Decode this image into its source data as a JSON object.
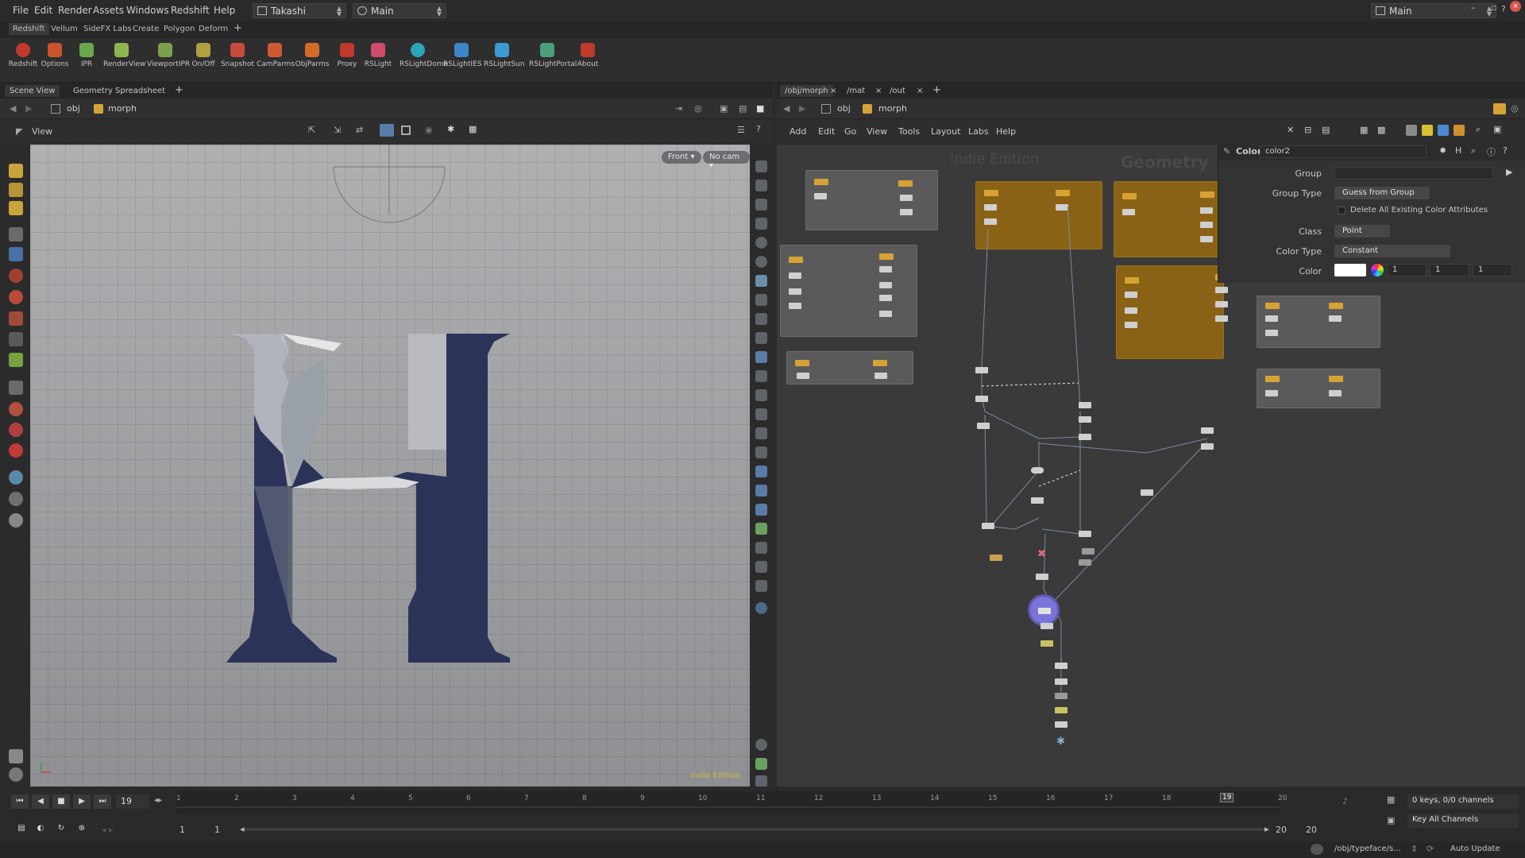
{
  "menubar": {
    "items": [
      "File",
      "Edit",
      "Render",
      "Assets",
      "Windows",
      "Redshift",
      "Help"
    ],
    "desktop": "Takashi",
    "network_selector": "Main",
    "right_desktop": "Main"
  },
  "shelf": {
    "tabs": [
      "Redshift",
      "Vellum",
      "SideFX Labs",
      "Create",
      "Polygon",
      "Deform"
    ],
    "tools": [
      "Redshift",
      "Options",
      "IPR",
      "RenderView",
      "ViewportIPR",
      "On/Off",
      "Snapshot",
      "CamParms",
      "ObjParms",
      "Proxy",
      "RSLight",
      "RSLightDome",
      "RSLightIES",
      "RSLightSun",
      "RSLightPortal",
      "About"
    ]
  },
  "left_pane": {
    "tabs": [
      "Scene View",
      "Geometry Spreadsheet"
    ],
    "path": [
      "obj",
      "morph"
    ],
    "viewport_label": "View",
    "view_button": "Front",
    "camera_button": "No cam",
    "edition": "Indie Edition"
  },
  "right_pane": {
    "tabs": [
      "/obj/morph",
      "/mat",
      "/out"
    ],
    "path": [
      "obj",
      "morph"
    ],
    "menus": [
      "Add",
      "Edit",
      "Go",
      "View",
      "Tools",
      "Layout",
      "Labs",
      "Help"
    ],
    "watermark_edition": "Indie Edition",
    "watermark_context": "Geometry"
  },
  "params": {
    "node_type": "Color",
    "node_name": "color2",
    "group_label": "Group",
    "group_value": "",
    "group_type_label": "Group Type",
    "group_type_value": "Guess from Group",
    "delete_label": "Delete All Existing Color Attributes",
    "class_label": "Class",
    "class_value": "Point",
    "color_type_label": "Color Type",
    "color_type_value": "Constant",
    "color_label": "Color",
    "color_values": [
      "1",
      "1",
      "1"
    ],
    "swatch_color": "#ffffff"
  },
  "timeline": {
    "current_frame": "19",
    "ticks": [
      "1",
      "2",
      "3",
      "4",
      "5",
      "6",
      "7",
      "8",
      "9",
      "10",
      "11",
      "12",
      "13",
      "14",
      "15",
      "16",
      "17",
      "18",
      "19",
      "20"
    ],
    "range_start": "1",
    "range_start2": "1",
    "range_end": "20",
    "range_end2": "20",
    "keys_status": "0 keys, 0/0 channels",
    "key_all": "Key All Channels",
    "path": "/obj/typeface/s...",
    "update_mode": "Auto Update"
  },
  "colors": {
    "letter": "#2b3358",
    "orange_box": "#8a6215",
    "accent_node": "#7b74d8"
  }
}
